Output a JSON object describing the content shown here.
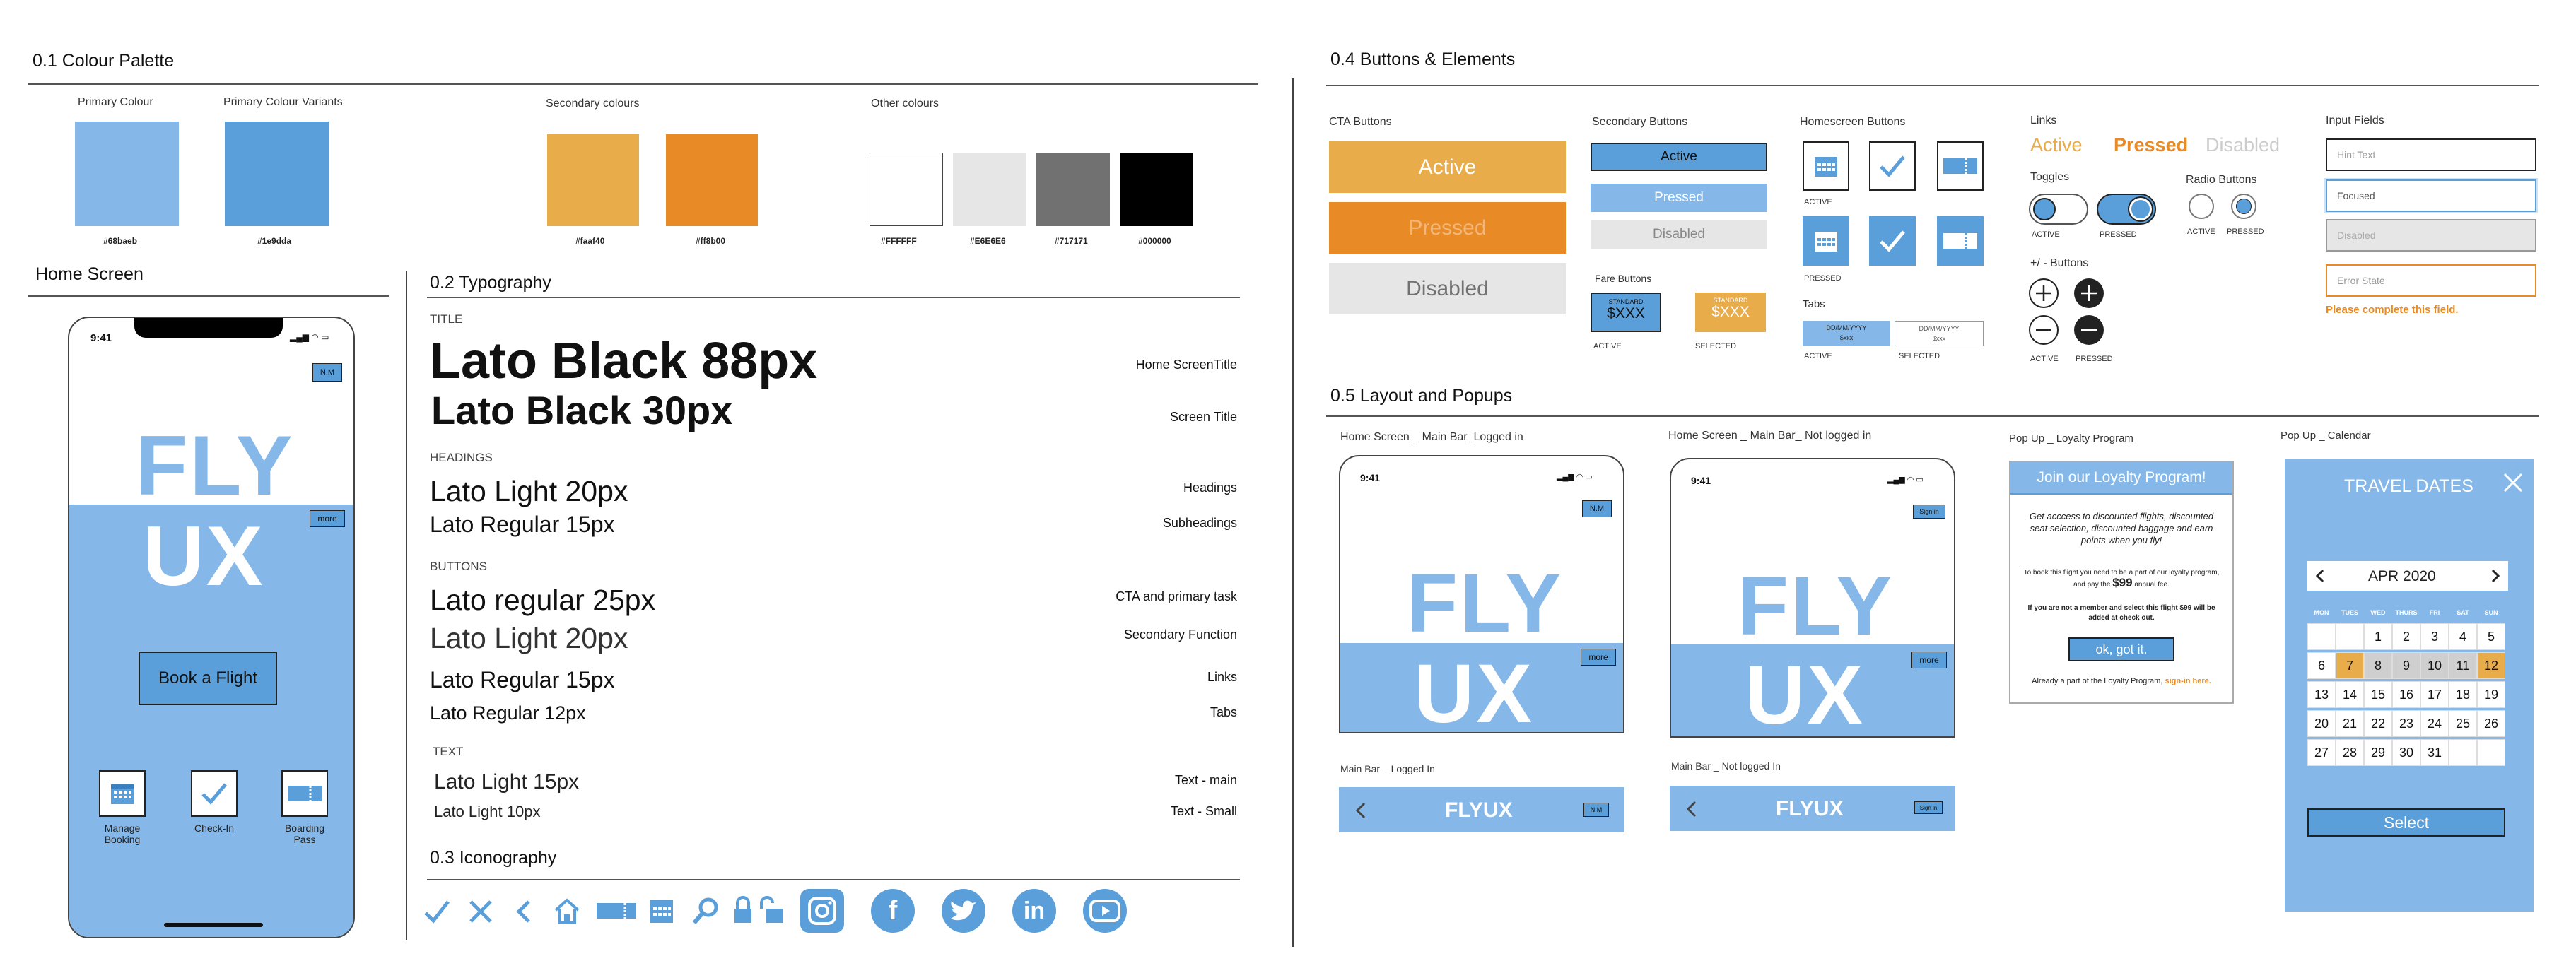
{
  "palette": {
    "title": "0.1 Colour Palette",
    "primary_label": "Primary Colour",
    "variants_label": "Primary Colour Variants",
    "secondary_label": "Secondary colours",
    "other_label": "Other colours",
    "swatches": [
      {
        "hex": "#68baeb",
        "color": "#85b8e8"
      },
      {
        "hex": "#1e9dda",
        "color": "#5a9fda"
      },
      {
        "hex": "#faaf40",
        "color": "#e8ac4a"
      },
      {
        "hex": "#ff8b00",
        "color": "#e88a25"
      },
      {
        "hex": "#FFFFFF",
        "color": "#ffffff"
      },
      {
        "hex": "#E6E6E6",
        "color": "#e6e6e6"
      },
      {
        "hex": "#717171",
        "color": "#717171"
      },
      {
        "hex": "#000000",
        "color": "#000000"
      }
    ]
  },
  "home": {
    "title": "Home Screen",
    "time": "9:41",
    "badge": "N.M",
    "fly": "FLY",
    "ux": "UX",
    "more": "more",
    "book": "Book a Flight",
    "tiles": [
      "Manage Booking",
      "Check-In",
      "Boarding Pass"
    ]
  },
  "typography": {
    "title": "0.2 Typography",
    "sections": {
      "title": "TITLE",
      "headings": "HEADINGS",
      "buttons": "BUTTONS",
      "text": "TEXT"
    },
    "rows": [
      {
        "sample": "Lato Black 88px",
        "use": "Home ScreenTitle"
      },
      {
        "sample": "Lato Black 30px",
        "use": "Screen Title"
      },
      {
        "sample": "Lato Light 20px",
        "use": "Headings"
      },
      {
        "sample": "Lato Regular 15px",
        "use": "Subheadings"
      },
      {
        "sample": "Lato regular 25px",
        "use": "CTA and primary task"
      },
      {
        "sample": "Lato Light 20px",
        "use": "Secondary Function"
      },
      {
        "sample": "Lato Regular 15px",
        "use": "Links"
      },
      {
        "sample": "Lato Regular 12px",
        "use": "Tabs"
      },
      {
        "sample": "Lato Light 15px",
        "use": "Text - main"
      },
      {
        "sample": "Lato Light 10px",
        "use": "Text - Small"
      }
    ]
  },
  "iconography": {
    "title": "0.3 Iconography",
    "icons": [
      "check-icon",
      "close-icon",
      "back-icon",
      "home-icon",
      "ticket-icon",
      "calendar-icon",
      "search-icon",
      "lock-icon",
      "unlock-icon",
      "instagram-icon",
      "facebook-icon",
      "twitter-icon",
      "linkedin-icon",
      "youtube-icon"
    ]
  },
  "buttons": {
    "title": "0.4 Buttons & Elements",
    "cta_label": "CTA Buttons",
    "cta": [
      "Active",
      "Pressed",
      "Disabled"
    ],
    "secondary_label": "Secondary Buttons",
    "secondary": [
      "Active",
      "Pressed",
      "Disabled"
    ],
    "fare_label": "Fare Buttons",
    "fare_top": "STANDARD",
    "fare_price": "$XXX",
    "fare_states": [
      "ACTIVE",
      "SELECTED"
    ],
    "homescreen_label": "Homescreen Buttons",
    "active": "ACTIVE",
    "pressed": "PRESSED",
    "tabs_label": "Tabs",
    "tab_date": "DD/MM/YYYY",
    "tab_price": "$xxx",
    "tab_states": [
      "ACTIVE",
      "SELECTED"
    ],
    "links_label": "Links",
    "links": [
      "Active",
      "Pressed",
      "Disabled"
    ],
    "toggles_label": "Toggles",
    "radio_label": "Radio Buttons",
    "plusminus_label": "+/ - Buttons",
    "input_label": "Input Fields",
    "inputs": [
      "Hint Text",
      "Focused",
      "Disabled",
      "Error State"
    ],
    "error_msg": "Please complete this field."
  },
  "layout": {
    "title": "0.5 Layout and Popups",
    "screen1_label": "Home Screen _ Main Bar_Logged in",
    "screen2_label": "Home Screen _ Main Bar_ Not logged in",
    "time": "9:41",
    "badge": "N.M",
    "signin": "Sign in",
    "fly": "FLY",
    "ux": "UX",
    "more": "more",
    "bar1_label": "Main Bar _ Logged In",
    "bar2_label": "Main Bar _  Not logged In",
    "bar_title": "FLYUX",
    "loyalty_label": "Pop Up _ Loyalty Program",
    "loyalty_title": "Join our Loyalty Program!",
    "loyalty_body": "Get acccess to discounted flights, discounted seat selection, discounted baggage and earn points when you fly!",
    "loyalty_fee_pre": "To book this flight you need to be a part of our loyalty program, and pay the",
    "loyalty_fee_amt": "$99",
    "loyalty_fee_post": "annual fee.",
    "loyalty_note": "If you are not a  member and select this flight $99 will be added at check out.",
    "loyalty_btn": "ok, got it.",
    "loyalty_footer": "Already a part of the Loyalty Program,",
    "loyalty_link": "sign-in here.",
    "calendar_label": "Pop Up _ Calendar",
    "calendar_title": "TRAVEL DATES",
    "calendar_month": "APR 2020",
    "dow": [
      "MON",
      "TUES",
      "WED",
      "THURS",
      "FRI",
      "SAT",
      "SUN"
    ],
    "select": "Select"
  }
}
